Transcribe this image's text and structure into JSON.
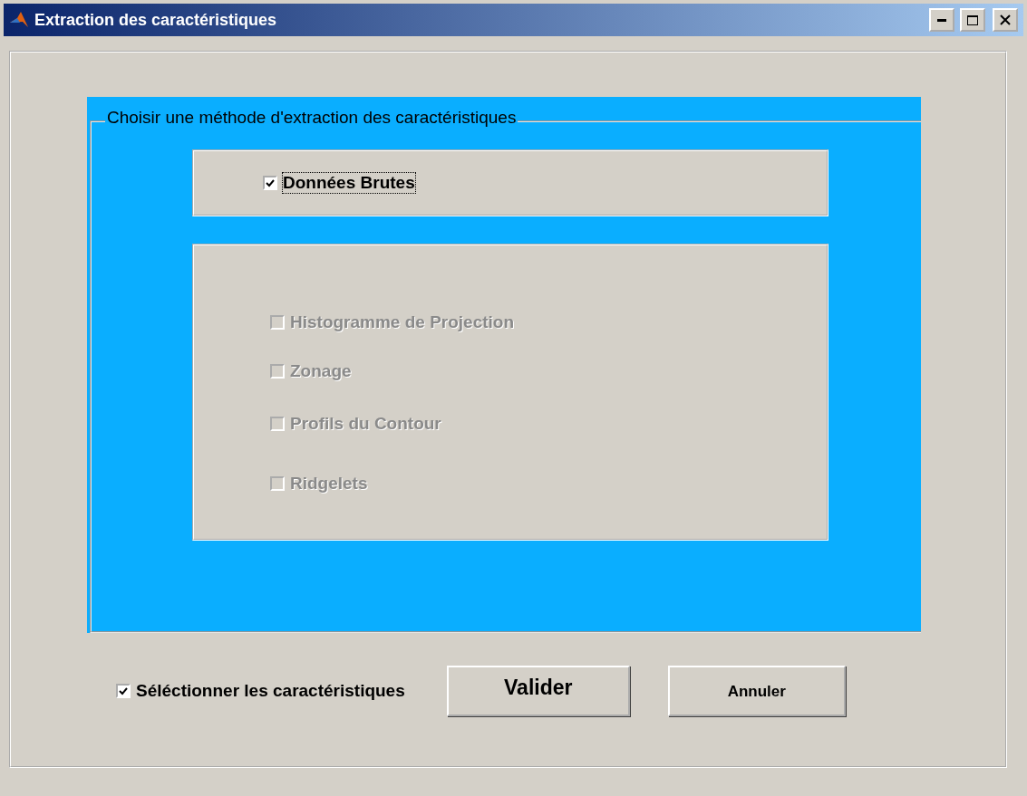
{
  "window": {
    "title": "Extraction des caractéristiques"
  },
  "method_group": {
    "title": "Choisir une méthode d'extraction des caractéristiques",
    "raw_panel": [
      {
        "label": "Données Brutes",
        "checked": true,
        "disabled": false,
        "focused": true
      }
    ],
    "feature_panel": [
      {
        "label": "Histogramme de Projection",
        "checked": false,
        "disabled": true,
        "focused": false
      },
      {
        "label": "Zonage",
        "checked": false,
        "disabled": true,
        "focused": false
      },
      {
        "label": "Profils du Contour",
        "checked": false,
        "disabled": true,
        "focused": false
      },
      {
        "label": "Ridgelets",
        "checked": false,
        "disabled": true,
        "focused": false
      }
    ]
  },
  "select_features": {
    "label": "Séléctionner les caractéristiques",
    "checked": true
  },
  "buttons": [
    {
      "label": "Valider",
      "kind": "large"
    },
    {
      "label": "Annuler",
      "kind": "normal"
    }
  ]
}
